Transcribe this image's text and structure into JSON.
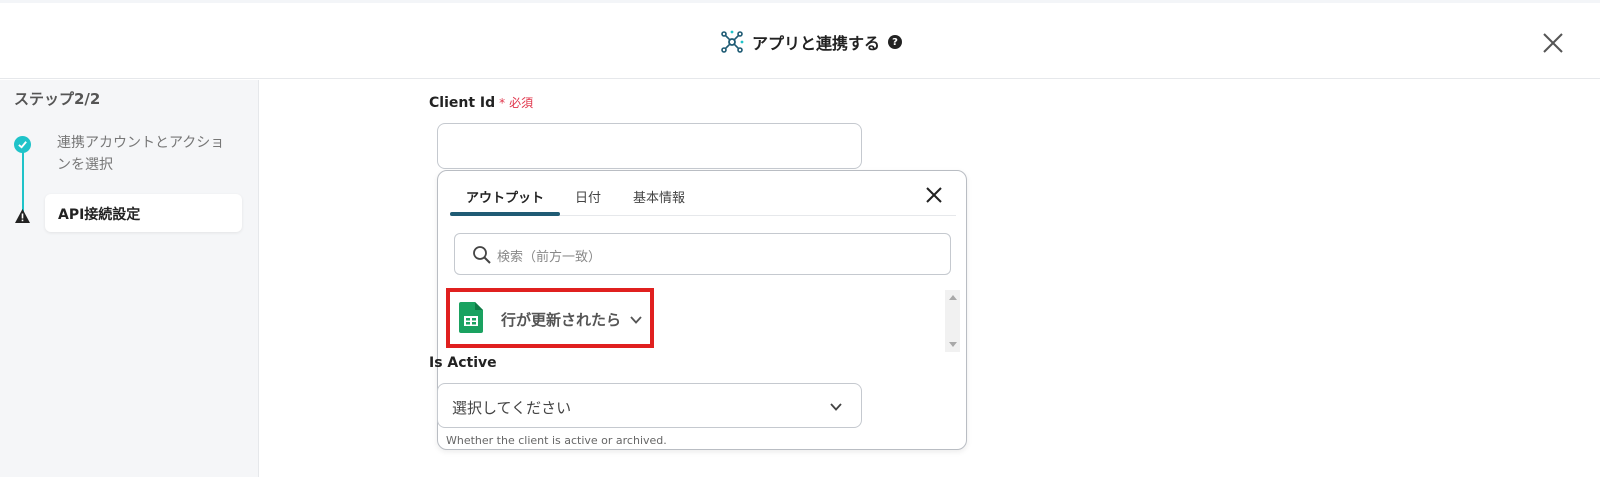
{
  "header": {
    "title": "アプリと連携する",
    "icon": "network-icon",
    "help_icon_glyph": "?",
    "close_icon": "close-icon"
  },
  "sidebar": {
    "step_title": "ステップ2/2",
    "steps": [
      {
        "label": "連携アカウントとアクションを選択",
        "status": "done"
      },
      {
        "label": "API接続設定",
        "status": "warning"
      }
    ]
  },
  "form": {
    "client_id_label": "Client Id",
    "required_label": "必須",
    "client_id_value": "",
    "is_active_label": "Is Active",
    "is_active_value": "選択してください",
    "is_active_help": "Whether the client is active or archived."
  },
  "popup": {
    "tabs": [
      {
        "label": "アウトプット",
        "active": true
      },
      {
        "label": "日付",
        "active": false
      },
      {
        "label": "基本情報",
        "active": false
      }
    ],
    "search_placeholder": "検索（前方一致）",
    "items": [
      {
        "label": "行が更新されたら",
        "icon": "google-sheets-icon",
        "highlighted": true
      }
    ]
  },
  "colors": {
    "accent_teal": "#1fc3c9",
    "tab_underline": "#1f5b74",
    "highlight_red": "#e0201f",
    "required_red": "#e0354b",
    "sheets_green": "#1aa260"
  }
}
